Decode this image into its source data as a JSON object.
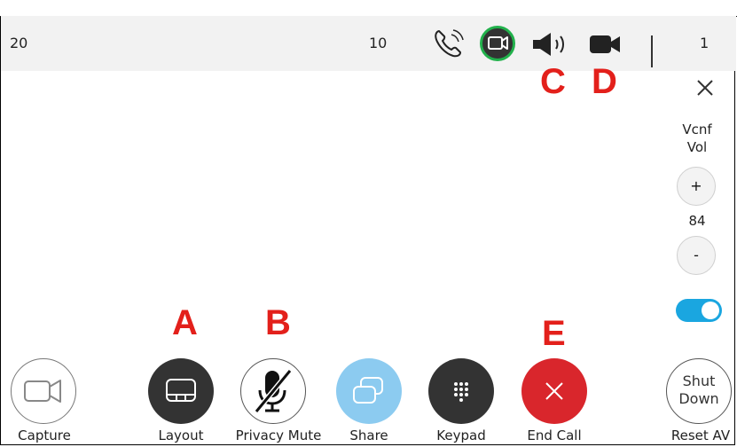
{
  "header": {
    "left_value": "20",
    "center_value": "10",
    "right_value": "1",
    "icons": [
      "phone-ringing-icon",
      "camera-active-icon",
      "speaker-icon",
      "camera-filled-icon"
    ],
    "active_icon_color": "#22b14c"
  },
  "annotations": {
    "a": "A",
    "b": "B",
    "c": "C",
    "d": "D",
    "e": "E",
    "color": "#e3201b"
  },
  "volume": {
    "title_line1": "Vcnf",
    "title_line2": "Vol",
    "plus_label": "+",
    "level": "84",
    "minus_label": "-",
    "toggle_on": true,
    "toggle_color": "#1aa6e0"
  },
  "controls": {
    "capture_label": "Capture",
    "layout_label": "Layout",
    "privacy_label": "Privacy Mute",
    "share_label": "Share",
    "keypad_label": "Keypad",
    "end_label": "End Call",
    "reset_label": "Reset AV",
    "shut_line1": "Shut",
    "shut_line2": "Down",
    "end_color": "#d9262c",
    "share_color": "#8ccbf0",
    "dark_color": "#333333"
  }
}
